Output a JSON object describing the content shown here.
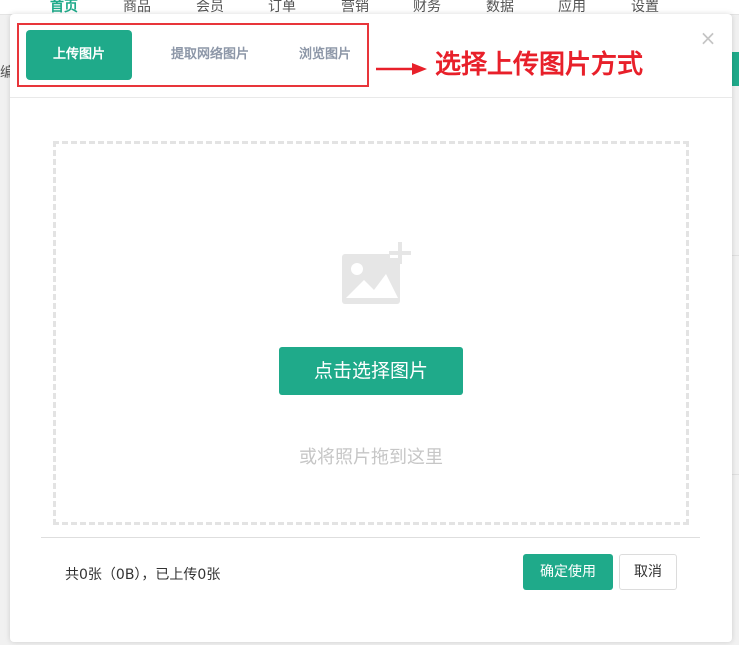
{
  "background": {
    "nav_items": [
      {
        "label": "首页"
      },
      {
        "label": "商品"
      },
      {
        "label": "会员"
      },
      {
        "label": "订单"
      },
      {
        "label": "营销"
      },
      {
        "label": "财务"
      },
      {
        "label": "数据"
      },
      {
        "label": "应用"
      },
      {
        "label": "设置"
      }
    ],
    "side_text": "编"
  },
  "modal": {
    "tabs": [
      {
        "label": "上传图片",
        "active": true
      },
      {
        "label": "提取网络图片",
        "active": false
      },
      {
        "label": "浏览图片",
        "active": false
      }
    ],
    "annotation": "选择上传图片方式",
    "close_symbol": "×",
    "upload": {
      "icon": "image-plus-icon",
      "select_label": "点击选择图片",
      "drag_hint": "或将照片拖到这里"
    },
    "footer": {
      "status": "共0张（0B），已上传0张",
      "confirm_label": "确定使用",
      "cancel_label": "取消"
    }
  },
  "colors": {
    "accent": "#1faa8a",
    "annotation_red": "#e8202a",
    "tab_inactive": "#8d97a8"
  }
}
